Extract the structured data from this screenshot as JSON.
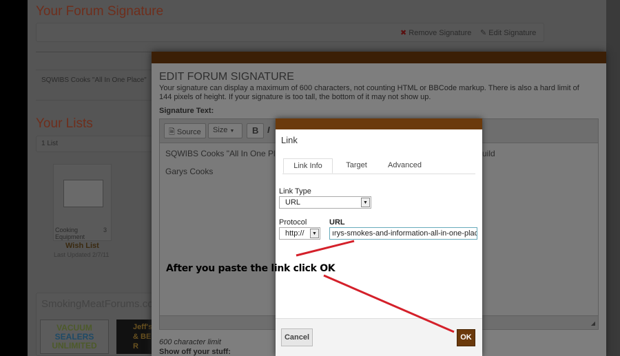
{
  "page": {
    "title": "Your Forum Signature",
    "remove_signature": "Remove Signature",
    "edit_signature": "Edit Signature",
    "signature_preview": "SQWIBS Cooks \"All In One Place\"",
    "lists_title": "Your Lists",
    "lists_count": "1 List",
    "list_card": {
      "category": "Cooking Equipment",
      "count": "3",
      "name": "Wish List",
      "updated": "Last Updated 2/7/11"
    },
    "sponsors_title": "SmokingMeatForums.com",
    "ad1": [
      "VACUUM",
      "SEALERS",
      "UNLIMITED"
    ],
    "ad2": [
      "Jeff's",
      "& BE",
      "R"
    ]
  },
  "edit_dialog": {
    "title": "EDIT FORUM SIGNATURE",
    "description": "Your signature can display a maximum of 600 characters, not counting HTML or BBCode markup. There is also a hard limit of 144 pixels of height. If your signature is too tall, the bottom of it may not show up.",
    "label": "Signature Text:",
    "toolbar": {
      "source": "Source",
      "size": "Size",
      "bold": "B",
      "italic": "I"
    },
    "content_line1": "SQWIBS Cooks \"All In One Place",
    "content_line1_tail": "uild",
    "content_line2": "Garys Cooks",
    "limit": "600 character limit",
    "show_off": "Show off your stuff:"
  },
  "link_dialog": {
    "title": "Link",
    "tabs": [
      "Link Info",
      "Target",
      "Advanced"
    ],
    "link_type_label": "Link Type",
    "link_type_value": "URL",
    "protocol_label": "Protocol",
    "protocol_value": "http://",
    "url_label": "URL",
    "url_value": "ırys-smokes-and-information-all-in-one-place",
    "cancel": "Cancel",
    "ok": "OK"
  },
  "annotation": {
    "text": "After you paste the link click OK",
    "color": "#d4202a"
  },
  "colors": {
    "brand_brown": "#6b3a0c"
  }
}
